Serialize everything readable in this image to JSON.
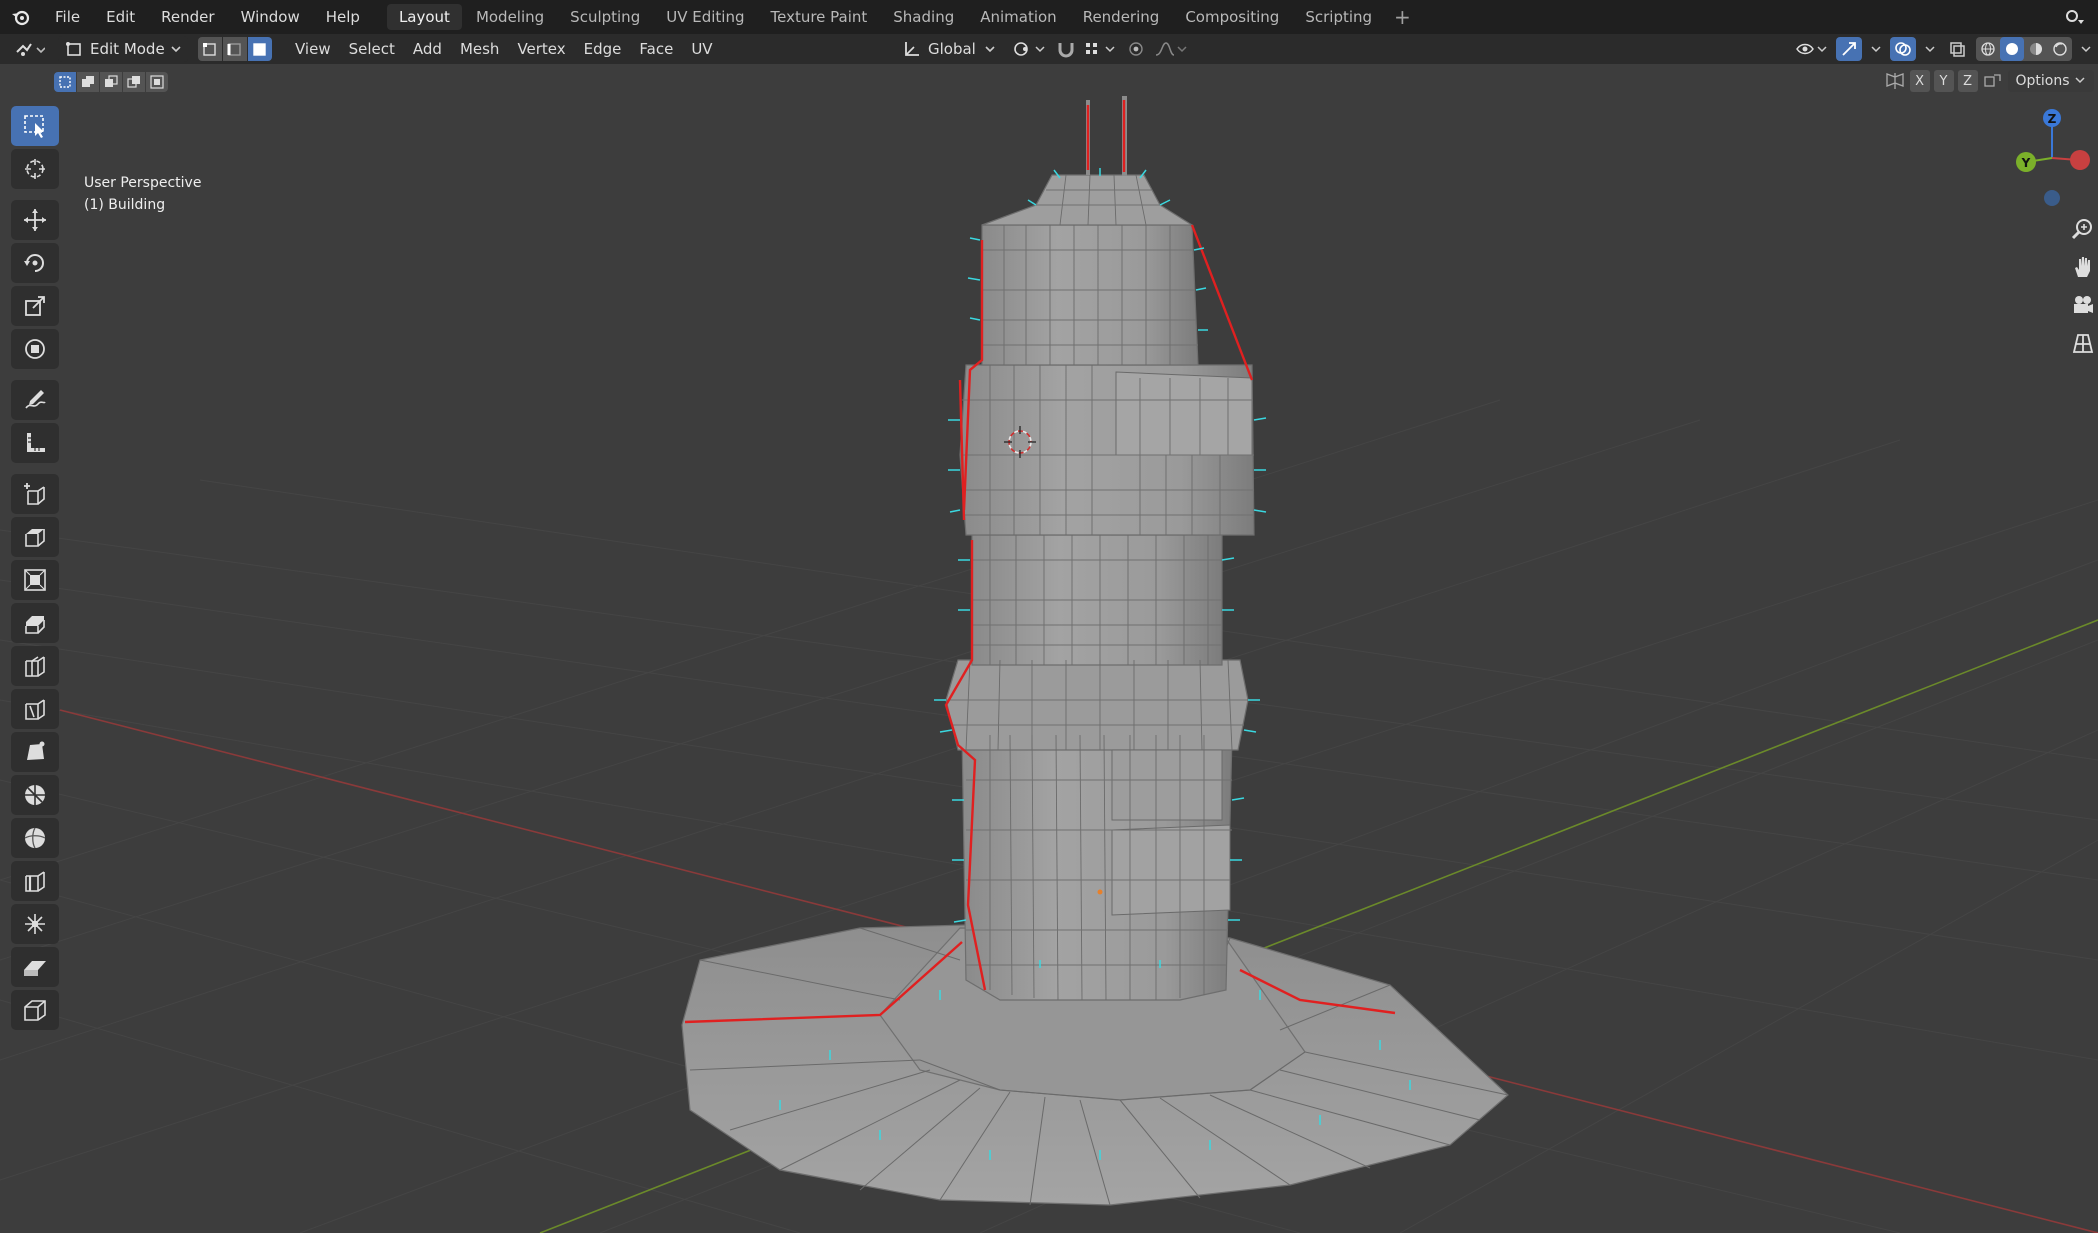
{
  "menu": {
    "items": [
      "File",
      "Edit",
      "Render",
      "Window",
      "Help"
    ]
  },
  "workspaces": {
    "tabs": [
      "Layout",
      "Modeling",
      "Sculpting",
      "UV Editing",
      "Texture Paint",
      "Shading",
      "Animation",
      "Rendering",
      "Compositing",
      "Scripting"
    ],
    "active": "Layout",
    "add_label": "+"
  },
  "header": {
    "mode": "Edit Mode",
    "menus": [
      "View",
      "Select",
      "Add",
      "Mesh",
      "Vertex",
      "Edge",
      "Face",
      "UV"
    ],
    "transform_orientation": "Global",
    "active_select_mode": "face"
  },
  "tool_settings": {
    "axes": [
      "X",
      "Y",
      "Z"
    ],
    "options_label": "Options"
  },
  "viewport": {
    "view_name": "User Perspective",
    "object_label": "(1) Building"
  },
  "gizmo": {
    "z_label": "Z",
    "y_label": "Y"
  },
  "colors": {
    "accent": "#4772b3",
    "background": "#3d3d3d",
    "grid_line": "#454545",
    "x_axis": "#8a3a3a",
    "y_axis": "#6b8a2a",
    "seam": "#e02020",
    "normals": "#3ad8e0",
    "mesh_face": "#9a9a9a"
  },
  "icons": {
    "tools": [
      "select-box-icon",
      "cursor-icon",
      "move-icon",
      "rotate-icon",
      "scale-icon",
      "transform-icon",
      "annotate-icon",
      "measure-icon",
      "add-cube-icon",
      "extrude-icon",
      "inset-icon",
      "bevel-icon",
      "loop-cut-icon",
      "knife-icon",
      "poly-build-icon",
      "spin-icon",
      "smooth-icon",
      "edge-slide-icon",
      "shrink-fatten-icon",
      "shear-icon",
      "rip-icon"
    ],
    "nav": [
      "zoom-icon",
      "pan-hand-icon",
      "camera-icon",
      "grid-view-icon"
    ]
  }
}
